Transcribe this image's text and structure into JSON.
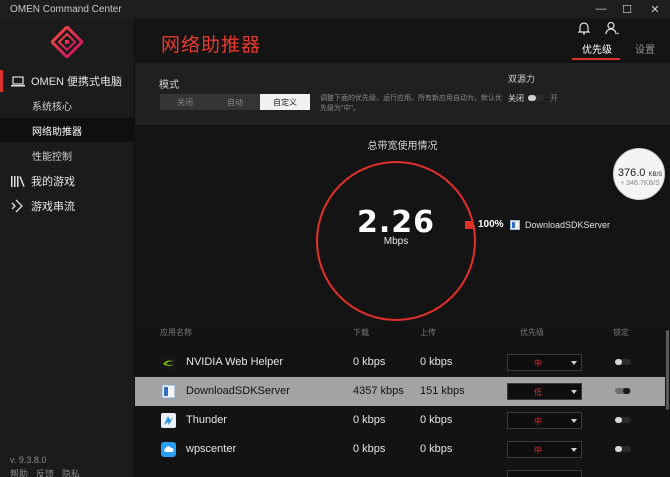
{
  "window": {
    "title": "OMEN Command Center",
    "controls": {
      "minimize": "—",
      "maximize": "☐",
      "close": "✕"
    }
  },
  "sidebar": {
    "main_item": "OMEN 便携式电脑",
    "sub_items": [
      "系统核心",
      "网络助推器",
      "性能控制"
    ],
    "active_sub": 1,
    "games": "我的游戏",
    "streaming": "游戏串流",
    "version": "v. 9.3.8.0",
    "footer": [
      "帮助",
      "反馈",
      "隐私"
    ]
  },
  "header": {
    "title": "网络助推器",
    "tabs": [
      "优先级",
      "设置"
    ],
    "active_tab": 0,
    "icons": [
      "bell-icon",
      "user-icon"
    ]
  },
  "mode": {
    "label": "模式",
    "options": [
      "关闭",
      "自动",
      "自定义"
    ],
    "selected": 2,
    "description": "调整下面的优先级，运行应用。所有新应用自动为，默认优先级为\"中\"。",
    "dual_source": {
      "label": "双源力",
      "off_label": "关闭",
      "on_label": "开",
      "state": "off"
    }
  },
  "usage": {
    "title": "总带宽使用情况",
    "value": "2.26",
    "unit": "Mbps",
    "legend": {
      "percent": "100%",
      "app": "DownloadSDKServer",
      "color": "#e0302a"
    }
  },
  "widget": {
    "download": "376.0",
    "download_unit": "KB/S",
    "upload": "+ 346.7KB/S"
  },
  "table": {
    "headers": {
      "app": "应用名称",
      "download": "下载",
      "upload": "上传",
      "priority": "优先级",
      "lock": "锁定"
    },
    "rows": [
      {
        "name": "NVIDIA Web Helper",
        "download": "0 kbps",
        "upload": "0 kbps",
        "priority": "中",
        "locked": false,
        "icon": "nvidia-icon"
      },
      {
        "name": "DownloadSDKServer",
        "download": "4357 kbps",
        "upload": "151 kbps",
        "priority": "低",
        "locked": true,
        "icon": "download-sdk-icon"
      },
      {
        "name": "Thunder",
        "download": "0 kbps",
        "upload": "0 kbps",
        "priority": "中",
        "locked": false,
        "icon": "thunder-icon"
      },
      {
        "name": "wpscenter",
        "download": "0 kbps",
        "upload": "0 kbps",
        "priority": "中",
        "locked": false,
        "icon": "wps-cloud-icon"
      }
    ],
    "selected_row": 1
  },
  "colors": {
    "accent": "#e0302a",
    "background": "#131313",
    "sidebar": "#1b1b1b",
    "selected_row": "#a3a3a3"
  }
}
